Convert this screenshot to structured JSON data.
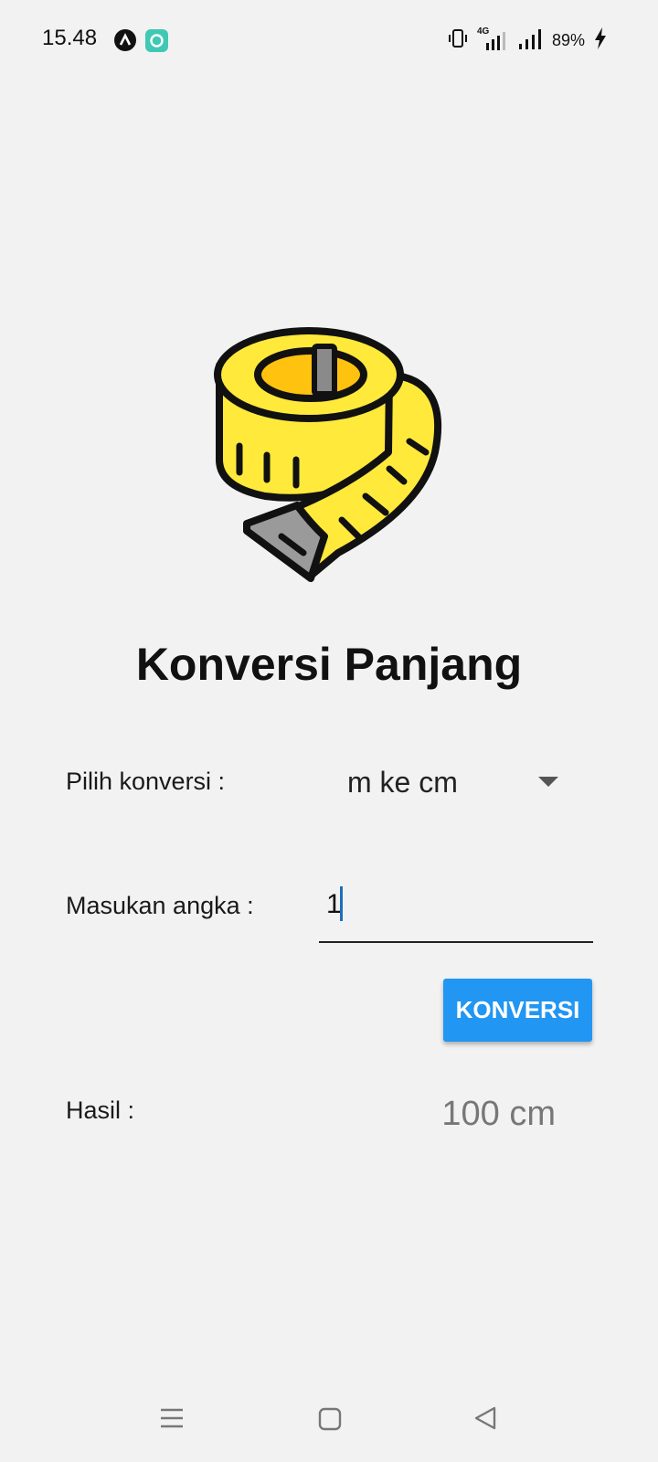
{
  "status_bar": {
    "time": "15.48",
    "network": "4G",
    "battery": "89%"
  },
  "app": {
    "title": "Konversi Panjang",
    "logo_icon": "measuring-tape-icon"
  },
  "form": {
    "convert_label": "Pilih konversi :",
    "convert_selected": "m ke cm",
    "input_label": "Masukan angka :",
    "input_value": "1",
    "button_label": "KONVERSI",
    "result_label": "Hasil :",
    "result_value": "100 cm"
  },
  "colors": {
    "accent": "#2196f3",
    "tape": "#ffe93b",
    "background": "#f2f2f2"
  }
}
